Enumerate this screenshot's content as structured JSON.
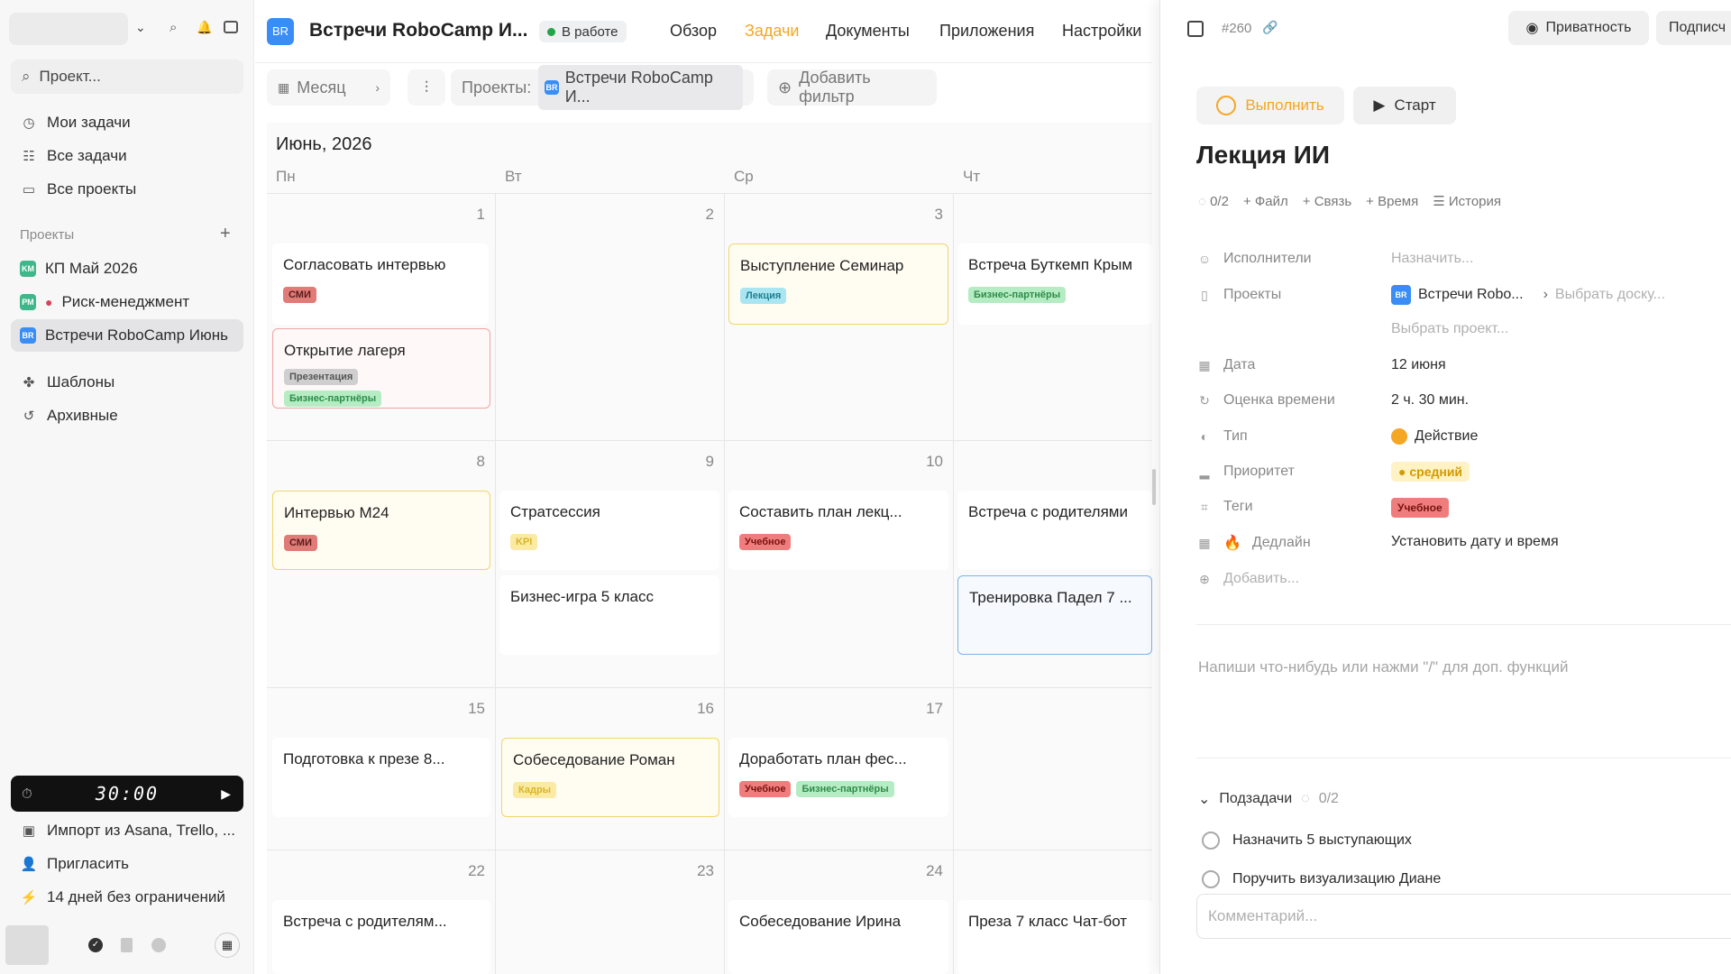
{
  "sidebar": {
    "search_placeholder": "Проект...",
    "nav": [
      "Мои задачи",
      "Все задачи",
      "Все проекты"
    ],
    "projects_heading": "Проекты",
    "projects": [
      {
        "badge": "KM",
        "label": "КП Май 2026",
        "color": "#3fb78a"
      },
      {
        "badge": "РМ",
        "label": "Риск-менеджмент",
        "color": "#3fb78a"
      },
      {
        "badge": "BR",
        "label": "Встречи RoboCamp Июнь",
        "color": "#3a8df5"
      }
    ],
    "extra": [
      "Шаблоны",
      "Архивные"
    ],
    "timer": "30:00",
    "bottom": [
      "Импорт из Asana, Trello, ...",
      "Пригласить",
      "14 дней без ограничений"
    ]
  },
  "header": {
    "badge": "BR",
    "title": "Встречи RoboCamp И...",
    "status": "В работе",
    "tabs": [
      "Обзор",
      "Задачи",
      "Документы",
      "Приложения",
      "Настройки"
    ],
    "active_tab": "Задачи"
  },
  "filters": {
    "view": "Месяц",
    "projects_label": "Проекты:",
    "project_value": "Встречи RoboCamp И...",
    "add_filter": "Добавить фильтр"
  },
  "calendar": {
    "month": "Июнь, 2026",
    "weekdays": [
      "Пн",
      "Вт",
      "Ср",
      "Чт"
    ],
    "weeks": [
      {
        "days": [
          "1",
          "2",
          "3",
          ""
        ]
      },
      {
        "days": [
          "8",
          "9",
          "10",
          ""
        ]
      },
      {
        "days": [
          "15",
          "16",
          "17",
          ""
        ]
      },
      {
        "days": [
          "22",
          "23",
          "24",
          ""
        ]
      }
    ],
    "cards": {
      "c1": {
        "title": "Согласовать интервью",
        "tags": [
          "СМИ"
        ]
      },
      "c2": {
        "title": "Открытие лагеря",
        "tags": [
          "Презентация",
          "Бизнес-партнёры"
        ]
      },
      "c3": {
        "title": "Выступление Семинар",
        "tags": [
          "Лекция"
        ]
      },
      "c4": {
        "title": "Встреча Буткемп Крым",
        "tags": [
          "Бизнес-партнёры"
        ]
      },
      "c5": {
        "title": "Интервью M24",
        "tags": [
          "СМИ"
        ]
      },
      "c6": {
        "title": "Стратсессия",
        "tags": [
          "KPI"
        ]
      },
      "c7": {
        "title": "Составить план лекц...",
        "tags": [
          "Учебное"
        ]
      },
      "c8": {
        "title": "Встреча с родителями",
        "tags": []
      },
      "c9": {
        "title": "Бизнес-игра 5 класс",
        "tags": []
      },
      "c10": {
        "title": "Тренировка Падел 7 ...",
        "tags": []
      },
      "c11": {
        "title": "Подготовка к презе 8...",
        "tags": []
      },
      "c12": {
        "title": "Собеседование Роман",
        "tags": [
          "Кадры"
        ]
      },
      "c13": {
        "title": "Доработать план фес...",
        "tags": [
          "Учебное",
          "Бизнес-партнёры"
        ]
      },
      "c14": {
        "title": "Встреча с родителям...",
        "tags": []
      },
      "c15": {
        "title": "Собеседование Ирина",
        "tags": []
      },
      "c16": {
        "title": "Преза 7 класс Чат-бот",
        "tags": []
      }
    }
  },
  "panel": {
    "task_id": "#260",
    "privacy": "Приватность",
    "subscribe": "Подписч",
    "complete": "Выполнить",
    "start": "Старт",
    "title": "Лекция ИИ",
    "meta": {
      "progress": "0/2",
      "file": "Файл",
      "link": "Связь",
      "time": "Время",
      "history": "История"
    },
    "props": {
      "assignees_label": "Исполнители",
      "assignees_value": "Назначить...",
      "projects_label": "Проекты",
      "project_value": "Встречи Robo...",
      "board_value": "Выбрать доску...",
      "choose_project": "Выбрать проект...",
      "date_label": "Дата",
      "date_value": "12 июня",
      "estimate_label": "Оценка времени",
      "estimate_value": "2 ч. 30 мин.",
      "type_label": "Тип",
      "type_value": "Действие",
      "priority_label": "Приоритет",
      "priority_value": "средний",
      "tags_label": "Теги",
      "tags_value": "Учебное",
      "deadline_label": "Дедлайн",
      "deadline_value": "Установить дату и время",
      "add": "Добавить..."
    },
    "editor_placeholder": "Напиши что-нибудь или нажми \"/\" для доп. функций",
    "subtasks_label": "Подзадачи",
    "subtasks_progress": "0/2",
    "subtasks": [
      "Назначить 5 выступающих",
      "Поручить визуализацию Диане"
    ],
    "comment_placeholder": "Комментарий..."
  },
  "colors": {
    "accent": "#f5a623",
    "tag_smi": "#e57373",
    "tag_green": "#61c47f",
    "tag_yellow": "#f0c93f",
    "tag_blue": "#56c6d8",
    "tag_red": "#ef6b6b"
  }
}
